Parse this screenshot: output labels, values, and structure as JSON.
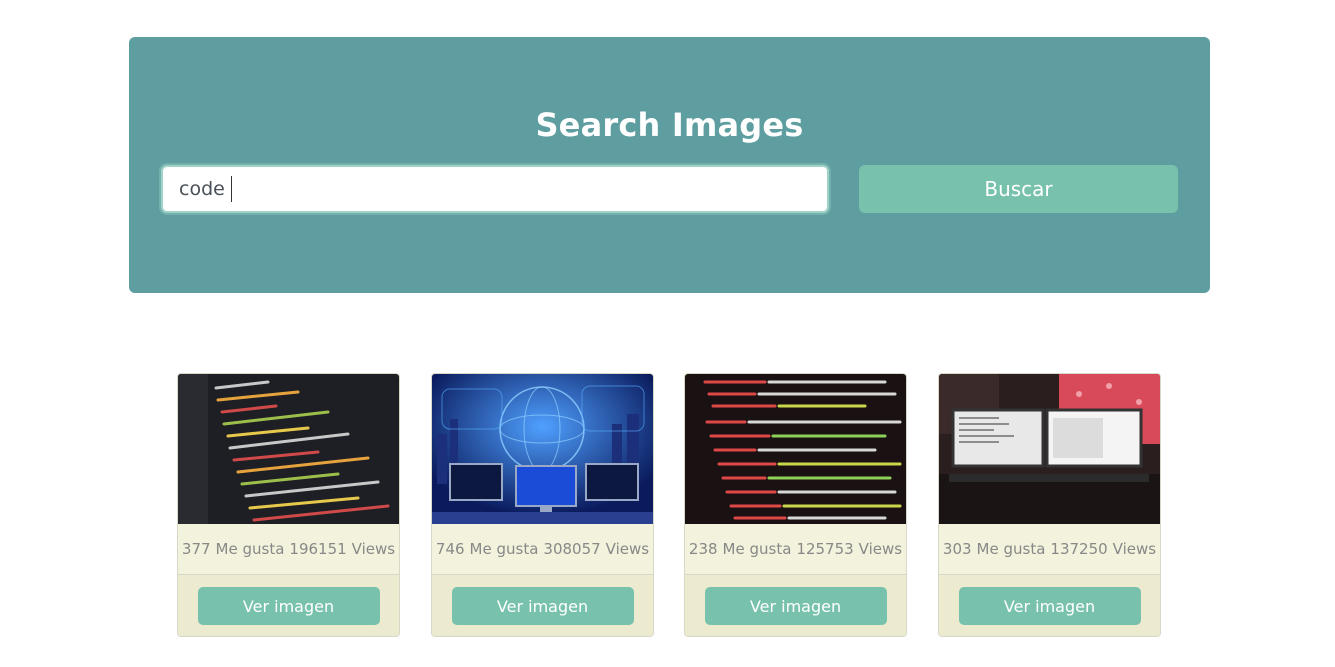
{
  "header": {
    "title": "Search Images"
  },
  "search": {
    "value": "code",
    "button_label": "Buscar"
  },
  "results": [
    {
      "likes": "377",
      "likes_label": "Me gusta",
      "views": "196151",
      "views_label": "Views",
      "button_label": "Ver imagen",
      "image": "code-editor-screen-image"
    },
    {
      "likes": "746",
      "likes_label": "Me gusta",
      "views": "308057",
      "views_label": "Views",
      "button_label": "Ver imagen",
      "image": "network-monitors-globe-image"
    },
    {
      "likes": "238",
      "likes_label": "Me gusta",
      "views": "125753",
      "views_label": "Views",
      "button_label": "Ver imagen",
      "image": "html-code-screen-image"
    },
    {
      "likes": "303",
      "likes_label": "Me gusta",
      "views": "137250",
      "views_label": "Views",
      "button_label": "Ver imagen",
      "image": "desk-monitors-setup-image"
    }
  ],
  "colors": {
    "jumbotron": "#5f9ea0",
    "accent": "#78c2ad",
    "card_bg": "#f3f2dc"
  }
}
